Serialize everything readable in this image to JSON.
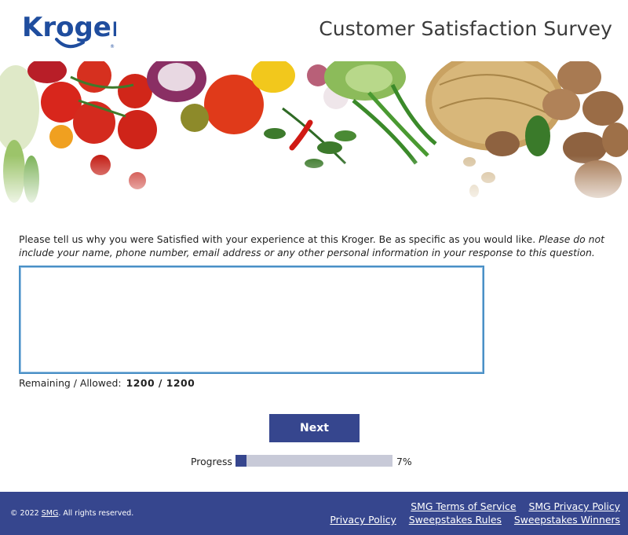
{
  "header": {
    "logo_text": "Kroger",
    "title": "Customer Satisfaction Survey"
  },
  "banner": {
    "description_icon": "vegetables-banner"
  },
  "question": {
    "text": "Please tell us why you were Satisfied with your experience at this Kroger. Be as specific as you would like.",
    "note": "Please do not include your name, phone number, email address or any other personal information in your response to this question."
  },
  "answer": {
    "value": "",
    "placeholder": ""
  },
  "counter": {
    "label": "Remaining / Allowed:",
    "value": "1200 / 1200"
  },
  "actions": {
    "next_label": "Next"
  },
  "progress": {
    "label": "Progress",
    "percent_text": "7%",
    "fraction": 0.07
  },
  "footer": {
    "copyright_prefix": "© 2022",
    "copyright_link": "SMG",
    "copyright_suffix": ". All rights reserved.",
    "links_row1": [
      "SMG Terms of Service",
      "SMG Privacy Policy"
    ],
    "links_row2": [
      "Privacy Policy",
      "Sweepstakes Rules",
      "Sweepstakes Winners"
    ]
  },
  "colors": {
    "brand_blue": "#36468e",
    "kroger_blue": "#1f4d9e",
    "input_border": "#4a90c6",
    "progress_track": "#c8cad8"
  }
}
